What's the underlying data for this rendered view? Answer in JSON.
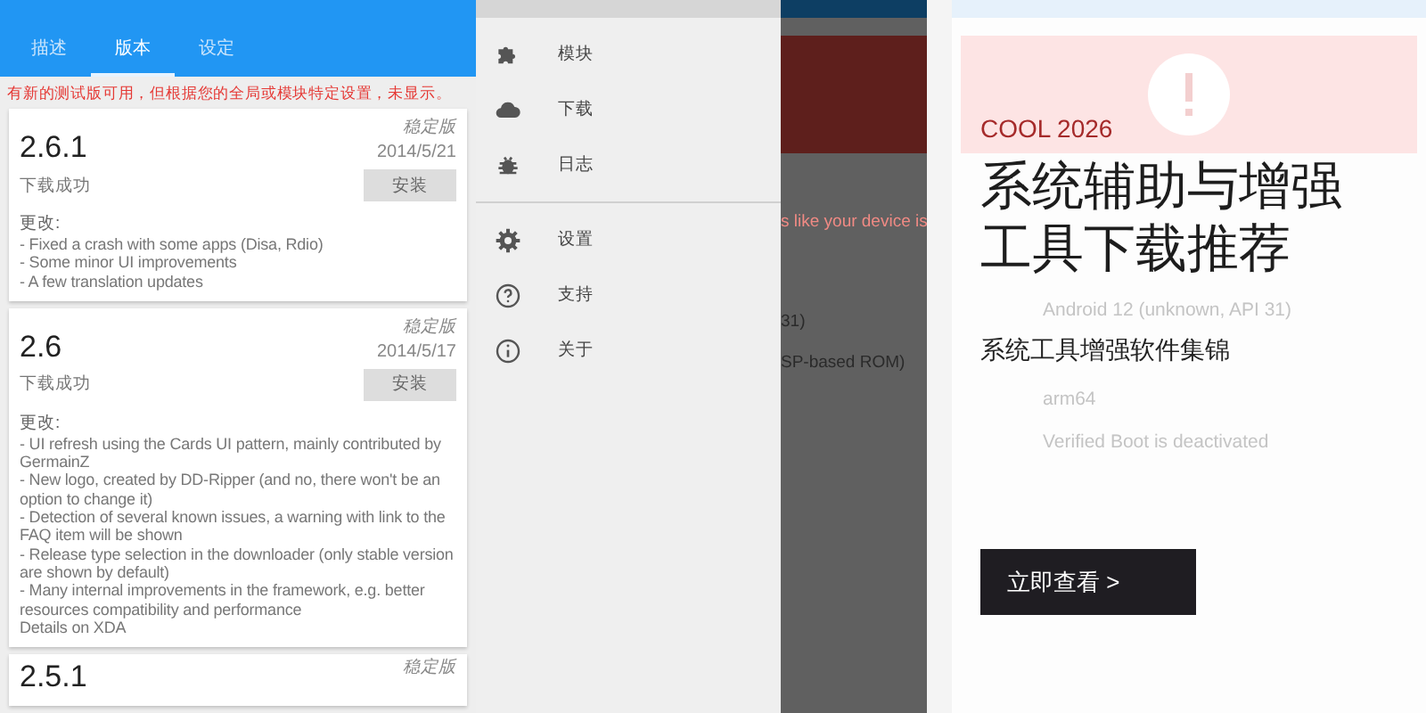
{
  "versions_screen": {
    "tabs": [
      {
        "label": "描述",
        "selected": false
      },
      {
        "label": "版本",
        "selected": true
      },
      {
        "label": "设定",
        "selected": false
      }
    ],
    "notice": "有新的测试版可用，但根据您的全局或模块特定设置，未显示。",
    "versions": [
      {
        "version": "2.6.1",
        "type": "稳定版",
        "date": "2014/5/21",
        "status": "下载成功",
        "button": "安装",
        "changes_title": "更改:",
        "changes": [
          "- Fixed a crash with some apps (Disa, Rdio)",
          "- Some minor UI improvements",
          "- A few translation updates"
        ]
      },
      {
        "version": "2.6",
        "type": "稳定版",
        "date": "2014/5/17",
        "status": "下载成功",
        "button": "安装",
        "changes_title": "更改:",
        "changes": [
          "- UI refresh using the Cards UI pattern, mainly contributed by GermainZ",
          "- New logo, created by DD-Ripper (and no, there won't be an option to change it)",
          "- Detection of several known issues, a warning with link to the FAQ item will be shown",
          "- Release type selection in the downloader (only stable version are shown by default)",
          "- Many internal improvements in the framework, e.g. better resources compatibility and performance",
          "Details on XDA"
        ]
      },
      {
        "version": "2.5.1",
        "type": "稳定版"
      }
    ]
  },
  "drawer_screen": {
    "sections": [
      [
        {
          "kind": "puzzle",
          "label": "模块"
        },
        {
          "kind": "cloud",
          "label": "下载"
        },
        {
          "kind": "bug",
          "label": "日志"
        }
      ],
      [
        {
          "kind": "gear",
          "label": "设置"
        },
        {
          "kind": "help",
          "label": "支持"
        },
        {
          "kind": "info",
          "label": "关于"
        }
      ]
    ],
    "behind_fragments": [
      "s like your device is",
      "31)",
      "SP-based ROM)"
    ]
  },
  "promo": {
    "background_lines": [
      "Android 12 (unknown, API 31)",
      "arm64",
      "Verified Boot is deactivated"
    ],
    "eyebrow": "COOL 2026",
    "title": "系统辅助与增强工具下载推荐",
    "subtitle": "系统工具增强软件集锦",
    "button": "立即查看 >"
  }
}
